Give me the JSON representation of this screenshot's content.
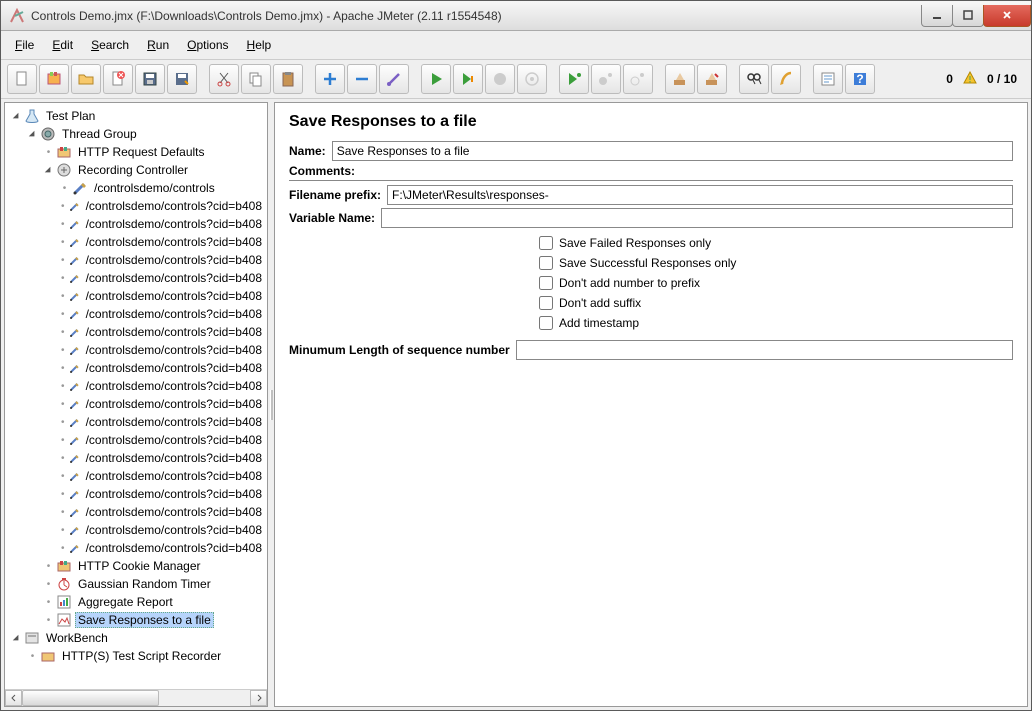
{
  "window": {
    "title": "Controls Demo.jmx (F:\\Downloads\\Controls Demo.jmx) - Apache JMeter (2.11 r1554548)"
  },
  "menu": [
    "File",
    "Edit",
    "Search",
    "Run",
    "Options",
    "Help"
  ],
  "toolbar_right": {
    "zero": "0",
    "slash": "0 / 10"
  },
  "tree": {
    "testPlan": "Test Plan",
    "threadGroup": "Thread Group",
    "httpReqDefaults": "HTTP Request Defaults",
    "recordingController": "Recording Controller",
    "requests": [
      "/controlsdemo/controls",
      "/controlsdemo/controls?cid=b408",
      "/controlsdemo/controls?cid=b408",
      "/controlsdemo/controls?cid=b408",
      "/controlsdemo/controls?cid=b408",
      "/controlsdemo/controls?cid=b408",
      "/controlsdemo/controls?cid=b408",
      "/controlsdemo/controls?cid=b408",
      "/controlsdemo/controls?cid=b408",
      "/controlsdemo/controls?cid=b408",
      "/controlsdemo/controls?cid=b408",
      "/controlsdemo/controls?cid=b408",
      "/controlsdemo/controls?cid=b408",
      "/controlsdemo/controls?cid=b408",
      "/controlsdemo/controls?cid=b408",
      "/controlsdemo/controls?cid=b408",
      "/controlsdemo/controls?cid=b408",
      "/controlsdemo/controls?cid=b408",
      "/controlsdemo/controls?cid=b408",
      "/controlsdemo/controls?cid=b408",
      "/controlsdemo/controls?cid=b408"
    ],
    "cookieMgr": "HTTP Cookie Manager",
    "gaussTimer": "Gaussian Random Timer",
    "aggReport": "Aggregate Report",
    "saveResp": "Save Responses to a file",
    "workbench": "WorkBench",
    "recorder": "HTTP(S) Test Script Recorder"
  },
  "detail": {
    "title": "Save Responses to a file",
    "labels": {
      "name": "Name:",
      "comments": "Comments:",
      "prefix": "Filename prefix:",
      "varname": "Variable Name:",
      "minlen": "Minumum Length of sequence number"
    },
    "values": {
      "name": "Save Responses to a file",
      "prefix": "F:\\JMeter\\Results\\responses-",
      "varname": "",
      "minlen": ""
    },
    "checks": [
      "Save Failed Responses only",
      "Save Successful Responses only",
      "Don't add number to prefix",
      "Don't add suffix",
      "Add timestamp"
    ]
  }
}
